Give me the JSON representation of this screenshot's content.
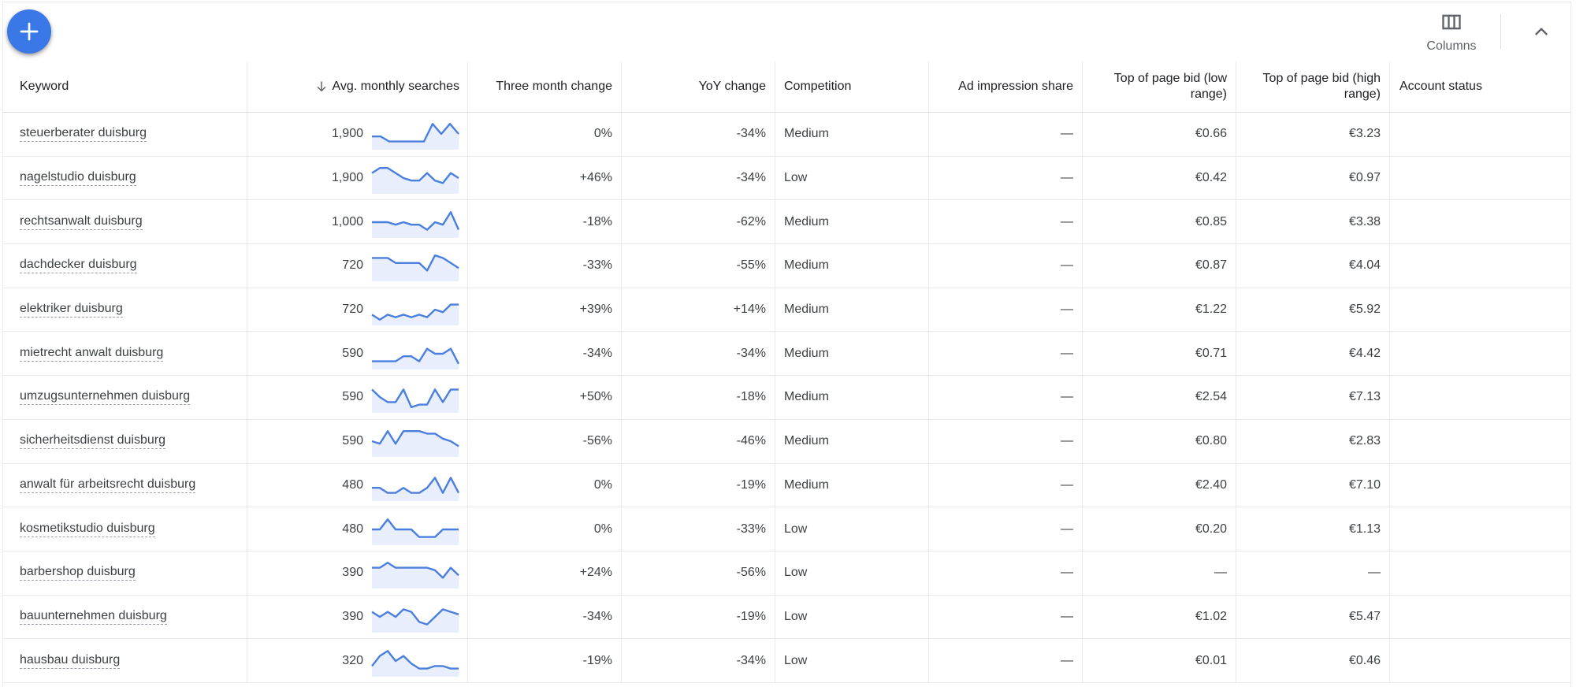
{
  "toolbar": {
    "columns_label": "Columns"
  },
  "colors": {
    "accent": "#3b78e7",
    "spark_line": "#4a7fdf",
    "spark_fill": "#e8eefb"
  },
  "headers": {
    "keyword": "Keyword",
    "avg": "Avg. monthly searches",
    "three_month": "Three month change",
    "yoy": "YoY change",
    "competition": "Competition",
    "ad_share": "Ad impression share",
    "bid_low": "Top of page bid (low range)",
    "bid_high": "Top of page bid (high range)",
    "account_status": "Account status"
  },
  "rows": [
    {
      "keyword": "steuerberater duisburg",
      "avg": "1,900",
      "three": "0%",
      "yoy": "-34%",
      "comp": "Medium",
      "share": "—",
      "low": "€0.66",
      "high": "€3.23",
      "trend": [
        4,
        4,
        2,
        2,
        2,
        2,
        2,
        9,
        5,
        9,
        5
      ]
    },
    {
      "keyword": "nagelstudio duisburg",
      "avg": "1,900",
      "three": "+46%",
      "yoy": "-34%",
      "comp": "Low",
      "share": "—",
      "low": "€0.42",
      "high": "€0.97",
      "trend": [
        7,
        9,
        9,
        7,
        5,
        4,
        4,
        7,
        4,
        3,
        7,
        5
      ]
    },
    {
      "keyword": "rechtsanwalt duisburg",
      "avg": "1,000",
      "three": "-18%",
      "yoy": "-62%",
      "comp": "Medium",
      "share": "—",
      "low": "€0.85",
      "high": "€3.38",
      "trend": [
        5,
        5,
        5,
        4,
        5,
        4,
        4,
        2,
        5,
        4,
        9,
        2
      ]
    },
    {
      "keyword": "dachdecker duisburg",
      "avg": "720",
      "three": "-33%",
      "yoy": "-55%",
      "comp": "Medium",
      "share": "—",
      "low": "€0.87",
      "high": "€4.04",
      "trend": [
        8,
        8,
        8,
        6,
        6,
        6,
        6,
        3,
        9,
        8,
        6,
        4
      ]
    },
    {
      "keyword": "elektriker duisburg",
      "avg": "720",
      "three": "+39%",
      "yoy": "+14%",
      "comp": "Medium",
      "share": "—",
      "low": "€1.22",
      "high": "€5.92",
      "trend": [
        3,
        1,
        3,
        2,
        3,
        2,
        3,
        2,
        5,
        4,
        7,
        7
      ]
    },
    {
      "keyword": "mietrecht anwalt duisburg",
      "avg": "590",
      "three": "-34%",
      "yoy": "-34%",
      "comp": "Medium",
      "share": "—",
      "low": "€0.71",
      "high": "€4.42",
      "trend": [
        2,
        2,
        2,
        2,
        4,
        4,
        2,
        7,
        5,
        5,
        7,
        1
      ]
    },
    {
      "keyword": "umzugsunternehmen duisburg",
      "avg": "590",
      "three": "+50%",
      "yoy": "-18%",
      "comp": "Medium",
      "share": "—",
      "low": "€2.54",
      "high": "€7.13",
      "trend": [
        8,
        5,
        3,
        3,
        8,
        1,
        2,
        2,
        8,
        3,
        8,
        8
      ]
    },
    {
      "keyword": "sicherheitsdienst duisburg",
      "avg": "590",
      "three": "-56%",
      "yoy": "-46%",
      "comp": "Medium",
      "share": "—",
      "low": "€0.80",
      "high": "€2.83",
      "trend": [
        5,
        4,
        9,
        4,
        9,
        9,
        9,
        8,
        8,
        6,
        5,
        3
      ]
    },
    {
      "keyword": "anwalt für arbeitsrecht duisburg",
      "avg": "480",
      "three": "0%",
      "yoy": "-19%",
      "comp": "Medium",
      "share": "—",
      "low": "€2.40",
      "high": "€7.10",
      "trend": [
        4,
        4,
        2,
        2,
        4,
        2,
        2,
        4,
        8,
        2,
        8,
        2
      ]
    },
    {
      "keyword": "kosmetikstudio duisburg",
      "avg": "480",
      "three": "0%",
      "yoy": "-33%",
      "comp": "Low",
      "share": "—",
      "low": "€0.20",
      "high": "€1.13",
      "trend": [
        5,
        5,
        9,
        5,
        5,
        5,
        2,
        2,
        2,
        5,
        5,
        5
      ]
    },
    {
      "keyword": "barbershop duisburg",
      "avg": "390",
      "three": "+24%",
      "yoy": "-56%",
      "comp": "Low",
      "share": "—",
      "low": "—",
      "high": "—",
      "trend": [
        7,
        7,
        9,
        7,
        7,
        7,
        7,
        7,
        6,
        3,
        7,
        4
      ]
    },
    {
      "keyword": "bauunternehmen duisburg",
      "avg": "390",
      "three": "-34%",
      "yoy": "-19%",
      "comp": "Low",
      "share": "—",
      "low": "€1.02",
      "high": "€5.47",
      "trend": [
        7,
        5,
        7,
        5,
        8,
        7,
        3,
        2,
        5,
        8,
        7,
        6
      ]
    },
    {
      "keyword": "hausbau duisburg",
      "avg": "320",
      "three": "-19%",
      "yoy": "-34%",
      "comp": "Low",
      "share": "—",
      "low": "€0.01",
      "high": "€0.46",
      "trend": [
        3,
        7,
        9,
        5,
        7,
        4,
        2,
        2,
        3,
        3,
        2,
        2
      ]
    }
  ]
}
